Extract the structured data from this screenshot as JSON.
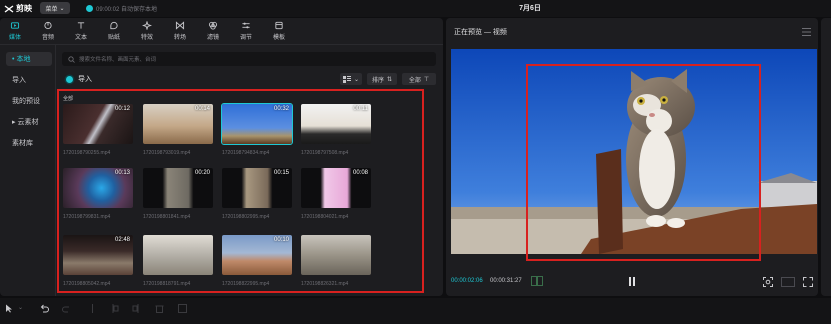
{
  "topbar": {
    "app_name": "剪映",
    "menu_label": "菜单",
    "save_status": "09:00:02 自动保存本地",
    "title": "7月6日"
  },
  "toolbar": {
    "tabs": [
      {
        "label": "媒体",
        "icon": "media-icon",
        "active": true
      },
      {
        "label": "音频",
        "icon": "audio-icon"
      },
      {
        "label": "文本",
        "icon": "text-icon"
      },
      {
        "label": "贴纸",
        "icon": "sticker-icon"
      },
      {
        "label": "特效",
        "icon": "effects-icon"
      },
      {
        "label": "转场",
        "icon": "transition-icon"
      },
      {
        "label": "滤镜",
        "icon": "filter-icon"
      },
      {
        "label": "调节",
        "icon": "adjust-icon"
      },
      {
        "label": "模板",
        "icon": "template-icon"
      }
    ]
  },
  "sidebar": {
    "items": [
      {
        "label": "本地",
        "active": true,
        "bullet": "•"
      },
      {
        "label": "导入"
      },
      {
        "label": "我的预设"
      },
      {
        "label": "云素材",
        "bullet": "▸"
      },
      {
        "label": "素材库"
      }
    ]
  },
  "media": {
    "search_placeholder": "搜索文件名称、画面元素、台词",
    "import_label": "导入",
    "sort_label": "排序",
    "filter_label": "全部",
    "section_label": "全部",
    "items": [
      {
        "duration": "00:12",
        "filename": "1720198790255.mp4"
      },
      {
        "duration": "00:14",
        "filename": "1720198793019.mp4"
      },
      {
        "duration": "00:32",
        "filename": "1720198794834.mp4",
        "selected": true
      },
      {
        "duration": "00:11",
        "filename": "1720198797508.mp4"
      },
      {
        "duration": "00:13",
        "filename": "1720198799831.mp4"
      },
      {
        "duration": "00:20",
        "filename": "1720198801841.mp4"
      },
      {
        "duration": "00:15",
        "filename": "1720198802995.mp4"
      },
      {
        "duration": "00:08",
        "filename": "1720198804021.mp4"
      },
      {
        "duration": "02:48",
        "filename": "1720198805042.mp4"
      },
      {
        "duration": "",
        "filename": "1720198818791.mp4"
      },
      {
        "duration": "00:10",
        "filename": "1720198822995.mp4"
      },
      {
        "duration": "",
        "filename": "1720198826321.mp4"
      }
    ]
  },
  "player": {
    "title": "正在预览 — 视频",
    "current_time": "00:00:02:06",
    "total_time": "00:00:31:27"
  },
  "colors": {
    "accent": "#1ec8d4",
    "highlight_box": "#d8211f",
    "panel": "#1d1d20",
    "background": "#0e0e10"
  }
}
